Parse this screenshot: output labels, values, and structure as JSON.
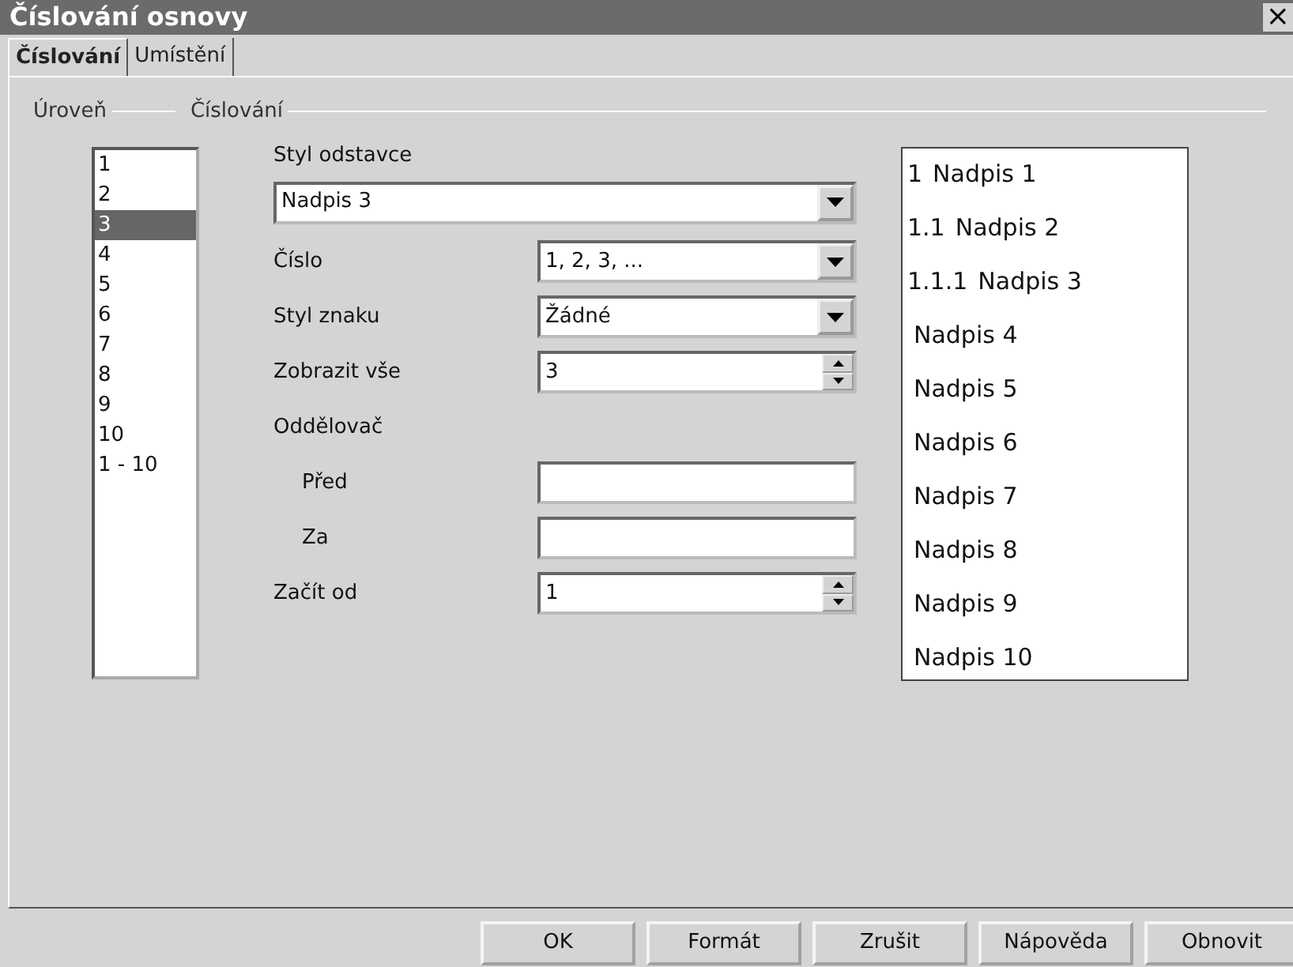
{
  "window": {
    "title": "Číslování osnovy",
    "close": "×"
  },
  "tabs": [
    {
      "label": "Číslování",
      "selected": true
    },
    {
      "label": "Umístění",
      "selected": false
    }
  ],
  "level_group": {
    "title": "Úroveň",
    "items": [
      {
        "label": "1",
        "selected": false
      },
      {
        "label": "2",
        "selected": false
      },
      {
        "label": "3",
        "selected": true
      },
      {
        "label": "4",
        "selected": false
      },
      {
        "label": "5",
        "selected": false
      },
      {
        "label": "6",
        "selected": false
      },
      {
        "label": "7",
        "selected": false
      },
      {
        "label": "8",
        "selected": false
      },
      {
        "label": "9",
        "selected": false
      },
      {
        "label": "10",
        "selected": false
      },
      {
        "label": "1 - 10",
        "selected": false
      }
    ]
  },
  "numbering_group": {
    "title": "Číslování",
    "paragraph_style": {
      "label": "Styl odstavce",
      "value": "Nadpis 3"
    },
    "fields": [
      {
        "kind": "combo",
        "label": "Číslo",
        "value": "1, 2, 3, ..."
      },
      {
        "kind": "combo",
        "label": "Styl znaku",
        "value": "Žádné"
      },
      {
        "kind": "spin",
        "label": "Zobrazit vše",
        "value": "3"
      },
      {
        "kind": "heading",
        "label": "Oddělovač"
      },
      {
        "kind": "text",
        "label": "Před"
      },
      {
        "kind": "text",
        "label": "Za"
      },
      {
        "kind": "spin",
        "label": "Začít od",
        "value": "1"
      }
    ]
  },
  "preview": [
    {
      "number": "1",
      "text": "Nadpis 1"
    },
    {
      "number": "1.1",
      "text": "Nadpis 2"
    },
    {
      "number": "1.1.1",
      "text": "Nadpis 3"
    },
    {
      "text": "Nadpis 4"
    },
    {
      "text": "Nadpis 5"
    },
    {
      "text": "Nadpis 6"
    },
    {
      "text": "Nadpis 7"
    },
    {
      "text": "Nadpis 8"
    },
    {
      "text": "Nadpis 9"
    },
    {
      "text": "Nadpis 10"
    }
  ],
  "buttons": [
    "OK",
    "Formát",
    "Zrušit",
    "Nápověda",
    "Obnovit"
  ]
}
